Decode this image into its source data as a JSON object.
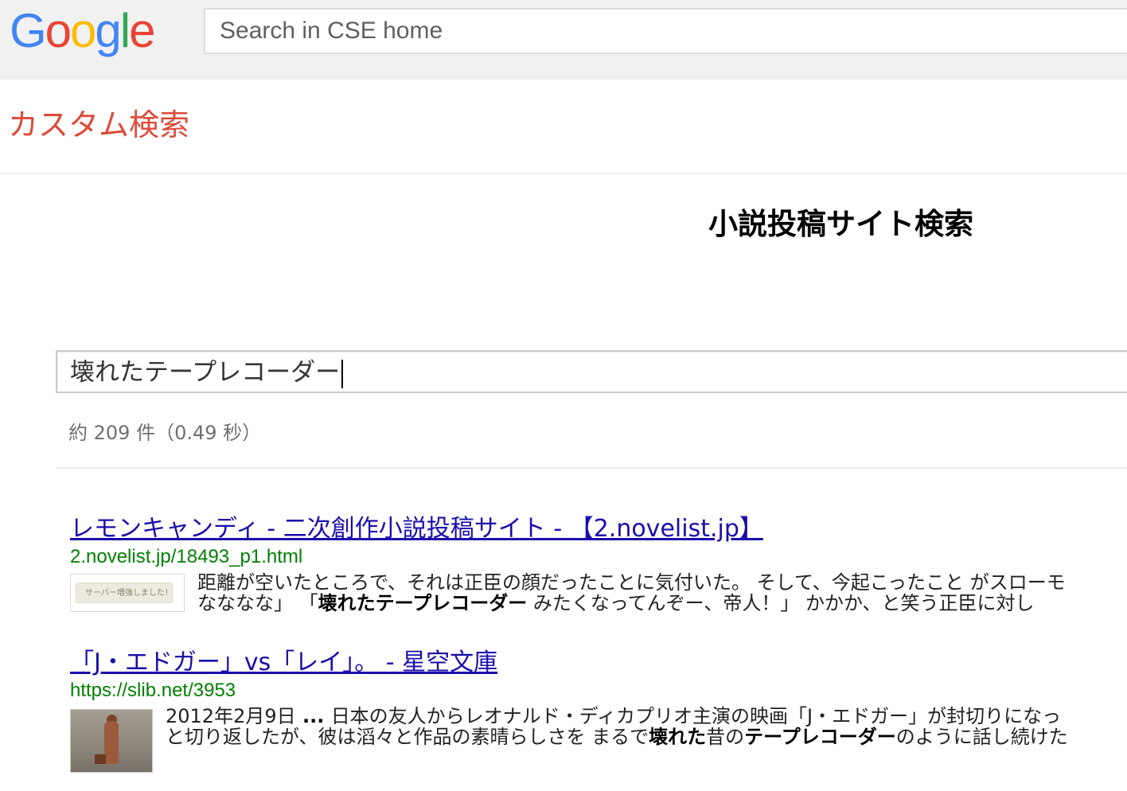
{
  "header": {
    "logo_letters": [
      {
        "char": "G",
        "color": "#4285F4"
      },
      {
        "char": "o",
        "color": "#EA4335"
      },
      {
        "char": "o",
        "color": "#FBBC05"
      },
      {
        "char": "g",
        "color": "#4285F4"
      },
      {
        "char": "l",
        "color": "#34A853"
      },
      {
        "char": "e",
        "color": "#EA4335"
      }
    ],
    "search_placeholder": "Search in CSE home"
  },
  "product_title": "カスタム検索",
  "engine_title": "小説投稿サイト検索",
  "query": "壊れたテープレコーダー",
  "result_stats": "約 209 件（0.49 秒）",
  "results": [
    {
      "title": "レモンキャンディ - 二次創作小説投稿サイト - 【2.novelist.jp】",
      "url": "2.novelist.jp/18493_p1.html",
      "thumbnail_caption": "サーバー増強しました！",
      "snippet_line1": "距離が空いたところで、それは正臣の顔だったことに気付いた。 そして、今起こったこと がスローモ",
      "snippet_line2_pre": "なななな」 「",
      "snippet_line2_bold": "壊れたテープレコーダー",
      "snippet_line2_post": " みたくなってんぞー、帝人！」 かかか、と笑う正臣に対し"
    },
    {
      "title": "「J・エドガー」vs「レイ」。 - 星空文庫",
      "url": "https://slib.net/3953",
      "snippet_line1_date": "2012年2月9日",
      "snippet_line1_ellipsis": " ... ",
      "snippet_line1_text": "日本の友人からレオナルド・ディカプリオ主演の映画「J・エドガー」が封切りになっ",
      "snippet_line2_pre": "と切り返したが、彼は滔々と作品の素晴らしさを まるで",
      "snippet_line2_bold1": "壊れた",
      "snippet_line2_mid": "昔の",
      "snippet_line2_bold2": "テープレコーダー",
      "snippet_line2_post": "のように話し続けた"
    }
  ]
}
